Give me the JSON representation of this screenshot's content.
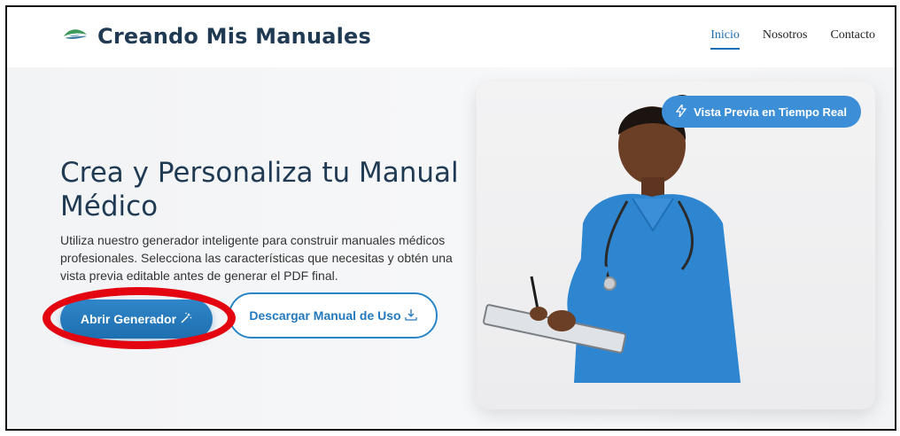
{
  "header": {
    "brand": "Creando Mis Manuales",
    "nav": [
      "Inicio",
      "Nosotros",
      "Contacto"
    ]
  },
  "hero": {
    "title": "Crea y Personaliza tu Manual Médico",
    "description": "Utiliza nuestro generador inteligente para construir manuales médicos profesionales. Selecciona las características que necesitas y obtén una vista previa editable antes de generar el PDF final.",
    "primary_button": "Abrir Generador",
    "secondary_button": "Descargar Manual de Uso",
    "badge": "Vista Previa en Tiempo Real"
  },
  "colors": {
    "brand": "#1f3a52",
    "accent": "#2a86c6",
    "highlight": "#e30611"
  },
  "icons": [
    "logo-leaf-icon",
    "magic-wand-icon",
    "download-icon",
    "lightning-icon"
  ]
}
